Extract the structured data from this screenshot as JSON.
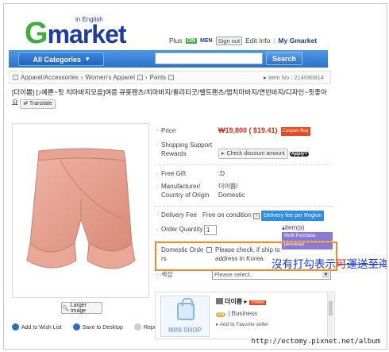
{
  "header": {
    "logo_g": "G",
    "logo_rest": "market",
    "logo_sub": "in English",
    "plus_label": "Plus",
    "plus_state": "ON",
    "men_label": "MEN",
    "signout_label": "Sign out",
    "editinfo_label": "Edit Info",
    "sep": "|",
    "mygmarket_label": "My Gmarket",
    "accent_color": "#1e3c9a",
    "green_color": "#3eae3c"
  },
  "nav": {
    "categories_label": "All Categories",
    "search_value": "",
    "search_button": "Search"
  },
  "breadcrumb": {
    "items": [
      "Apparel/Accessories",
      "Women's Apparel",
      "Pants"
    ],
    "item_no": "Item No : 214090814"
  },
  "product": {
    "title": "[더이쁨] [♪예쁜~핏 치마바지모음]여름 큐롯팬츠/치마바지/퀼리티굿/벨트팬츠/랩치마바지/면반바지/디자인~핏좋아요",
    "translate_label": "Translate",
    "enlarge_label": "Larger Image",
    "wishlist_label": "Add to Wish List",
    "desktop_label": "Save to Desktop",
    "report_label": "Report"
  },
  "info": {
    "price_label": "Price",
    "price_value": "₩19,800 ( $19.41)",
    "coupon_label": "Coupon Buy",
    "support_label": "Shopping Support Rewards",
    "discount_label": "Check discount amount",
    "applyplus_label": "Apply+",
    "freegift_label": "Free Gift",
    "freegift_value": ":D",
    "manufacturer_label": "Manufacturer/ Country of Origin",
    "manufacturer_value": "더이쁨/ Domestic",
    "delivery_label": "Delivery Fee",
    "delivery_value": "Free on condition",
    "delivery_fee_btn": "Delivery fee per Region",
    "order_qty_label": "Order Quantity",
    "order_qty_value": "1",
    "items_label": "item(s)",
    "multi_purchase_label": "Multi Purchase permitted",
    "domestic_order_label": "Domestic Orde rs",
    "domestic_order_note": "Please check, if ship to address in Korea.",
    "color_label": "색상",
    "color_select": "Please select."
  },
  "annotation": {
    "blue_text": "沒有打勾表示",
    "red_text": "可",
    "blue_text2": "運送至海外"
  },
  "seller": {
    "minishop_label": "MINI SHOP",
    "name": "더이쁨",
    "power_label": "Power",
    "cs_label": "CS",
    "type": "Business",
    "favorite_label": "Add to Favorite seller"
  },
  "watermark": "http://ectomy.pixnet.net/album"
}
